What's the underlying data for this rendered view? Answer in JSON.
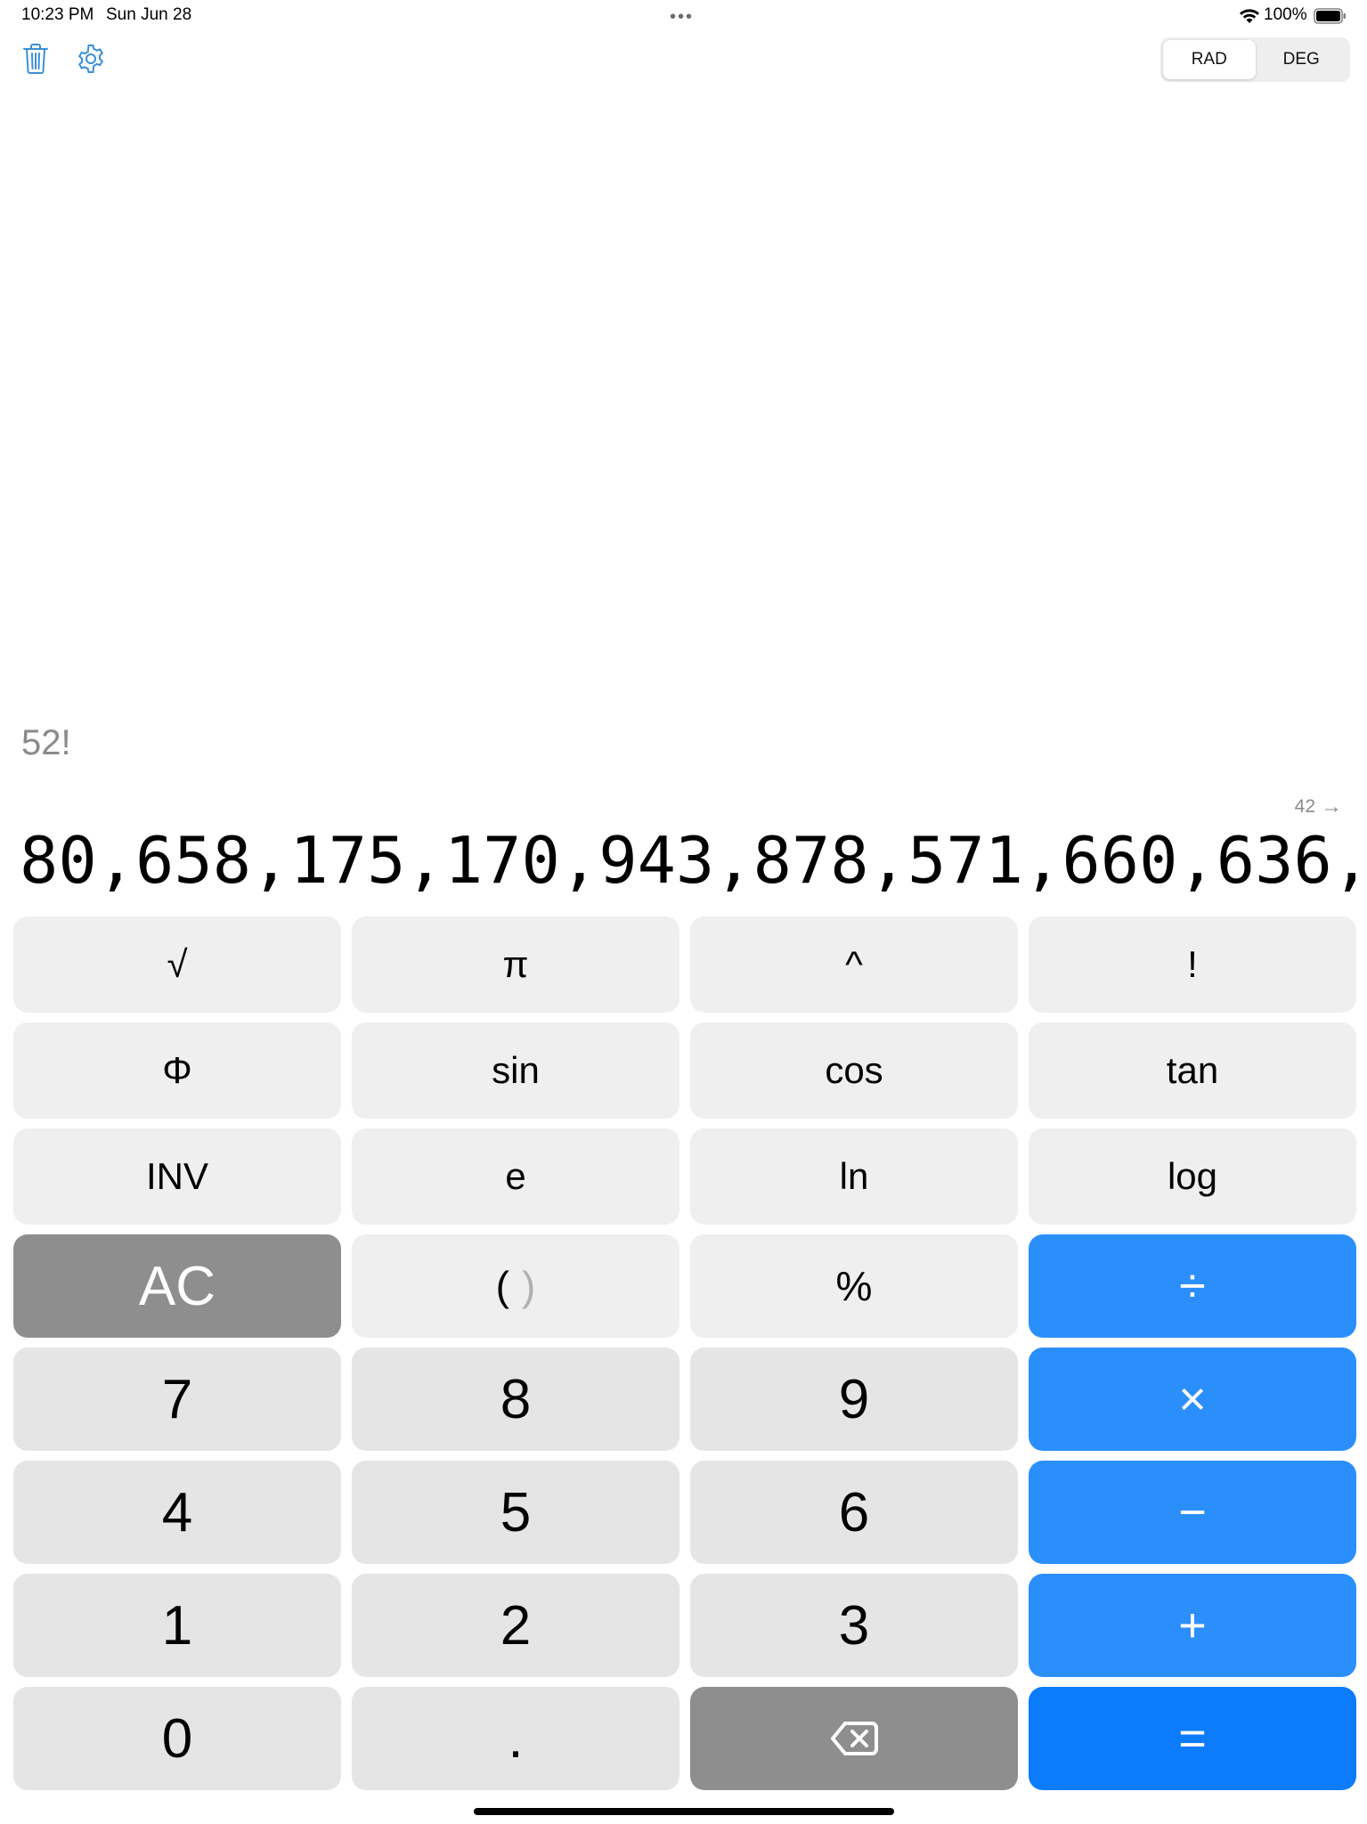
{
  "status_bar": {
    "time": "10:23 PM",
    "date": "Sun Jun 28",
    "battery": "100%",
    "icons": [
      "wifi-icon",
      "battery-icon",
      "multitask-dots-icon"
    ]
  },
  "toolbar": {
    "icons": [
      "trash-icon",
      "gear-icon"
    ],
    "angle_mode": {
      "options": [
        "RAD",
        "DEG"
      ],
      "selected": "RAD"
    }
  },
  "display": {
    "expression": "52!",
    "digit_count": "42",
    "result": "80,658,175,170,943,878,571,660,636,"
  },
  "keypad": {
    "sqrt": "√",
    "pi": "π",
    "power": "^",
    "factorial": "!",
    "phi": "Φ",
    "sin": "sin",
    "cos": "cos",
    "tan": "tan",
    "inv": "INV",
    "e": "e",
    "ln": "ln",
    "log": "log",
    "ac": "AC",
    "paren_open": "(",
    "paren_close": ")",
    "percent": "%",
    "divide": "÷",
    "seven": "7",
    "eight": "8",
    "nine": "9",
    "multiply": "×",
    "four": "4",
    "five": "5",
    "six": "6",
    "minus": "−",
    "one": "1",
    "two": "2",
    "three": "3",
    "plus": "+",
    "zero": "0",
    "decimal": ".",
    "backspace_icon": "backspace-icon",
    "equals": "="
  },
  "colors": {
    "function_key": "#efeff0",
    "number_key": "#e5e5e6",
    "dark_key": "#8e8e8e",
    "operator_key": "#2b8ffb",
    "equals_key": "#0d7cfc",
    "toolbar_icon": "#3b8fd9"
  }
}
